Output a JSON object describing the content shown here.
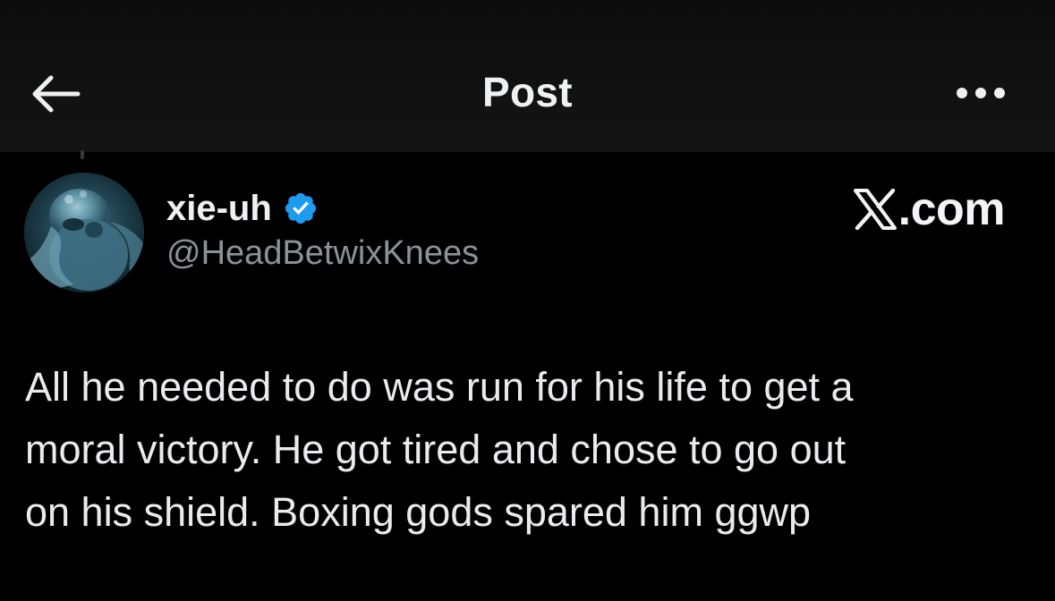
{
  "header": {
    "title": "Post",
    "back_icon": "arrow-left-icon",
    "more_icon": "more-horizontal-icon"
  },
  "author": {
    "display_name": "xie-uh",
    "handle": "@HeadBetwixKnees",
    "verified": true,
    "verified_color": "#1d9bf0",
    "avatar_icon": "avatar-image"
  },
  "watermark": {
    "logo_icon": "x-logo-icon",
    "text": ".com"
  },
  "post": {
    "lines": [
      "All he needed to do was run for his life to get a",
      "moral victory. He got tired and chose to go out",
      "on his shield. Boxing gods spared him ggwp"
    ]
  },
  "colors": {
    "background": "#000000",
    "header_background": "#111111",
    "text_primary": "#e7e9ea",
    "text_secondary": "#8b9298"
  }
}
